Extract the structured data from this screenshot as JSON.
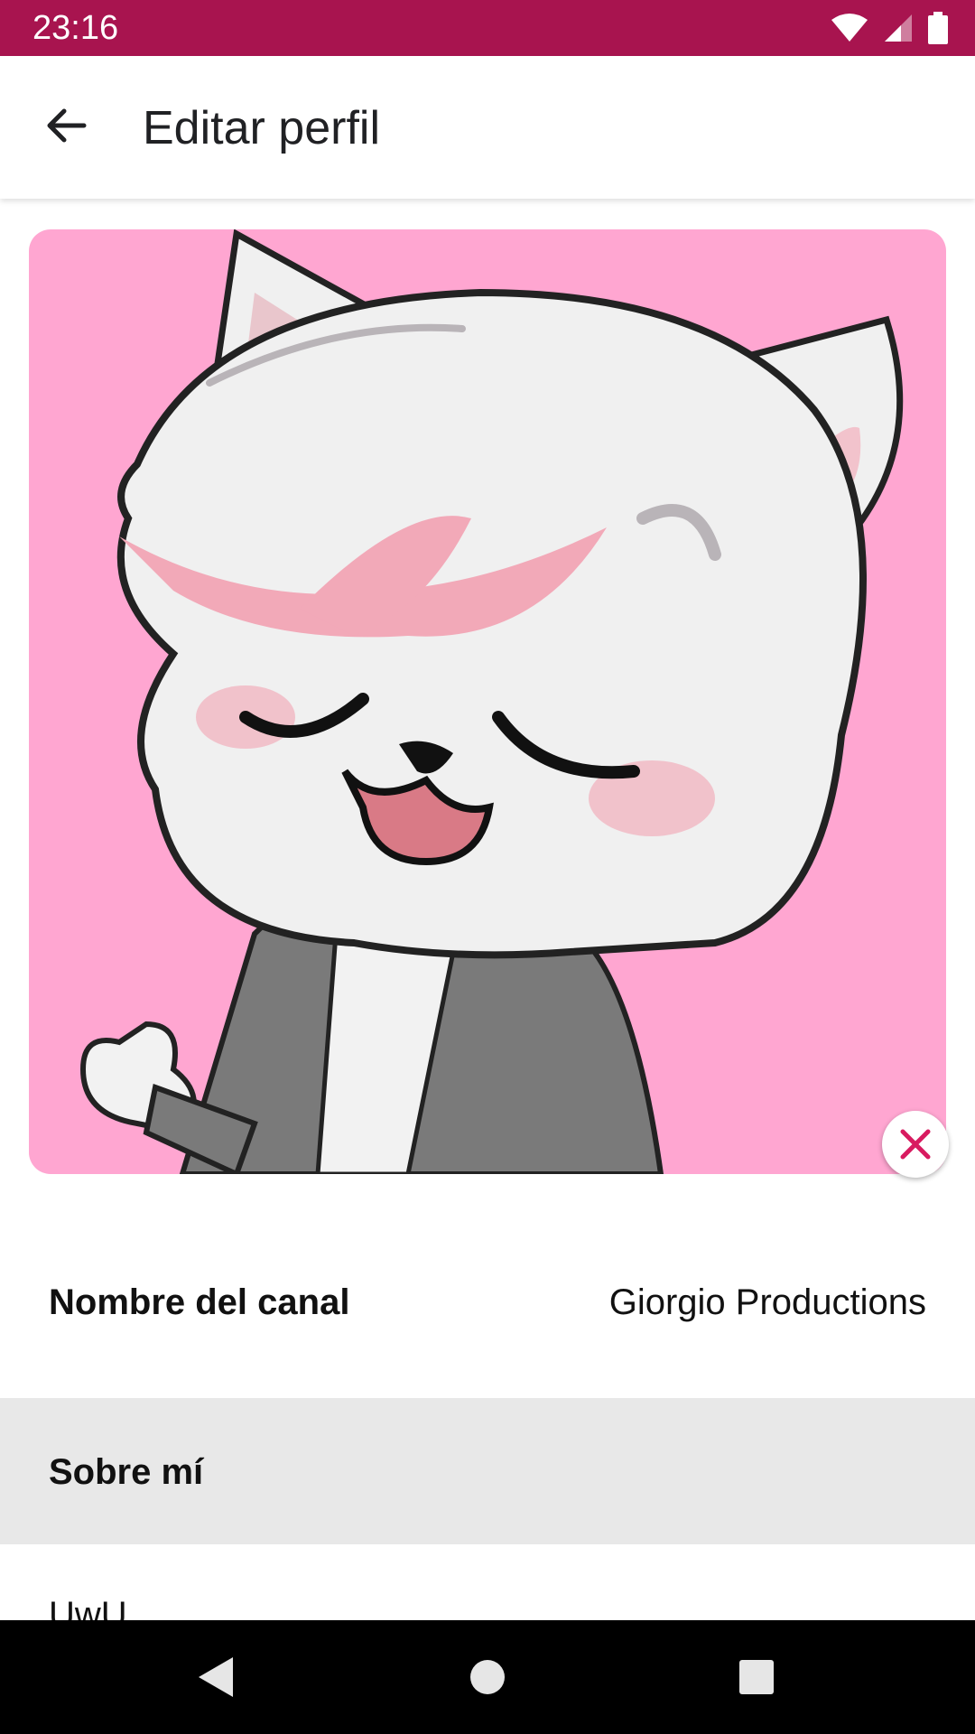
{
  "status_bar": {
    "time": "23:16",
    "icons": [
      "wifi-icon",
      "cell-signal-icon",
      "battery-icon"
    ],
    "color": "#a8144f"
  },
  "app_bar": {
    "title": "Editar perfil",
    "back_icon": "arrow-back-icon"
  },
  "banner": {
    "background_color": "#ffa6d1",
    "remove_icon": "close-icon",
    "remove_icon_color": "#d81b60"
  },
  "channel_name": {
    "label": "Nombre del canal",
    "value": "Giorgio Productions"
  },
  "about": {
    "label": "Sobre mí",
    "text": "UwU"
  },
  "nav_bar": {
    "icons": [
      "back-triangle-icon",
      "home-circle-icon",
      "recents-square-icon"
    ]
  }
}
